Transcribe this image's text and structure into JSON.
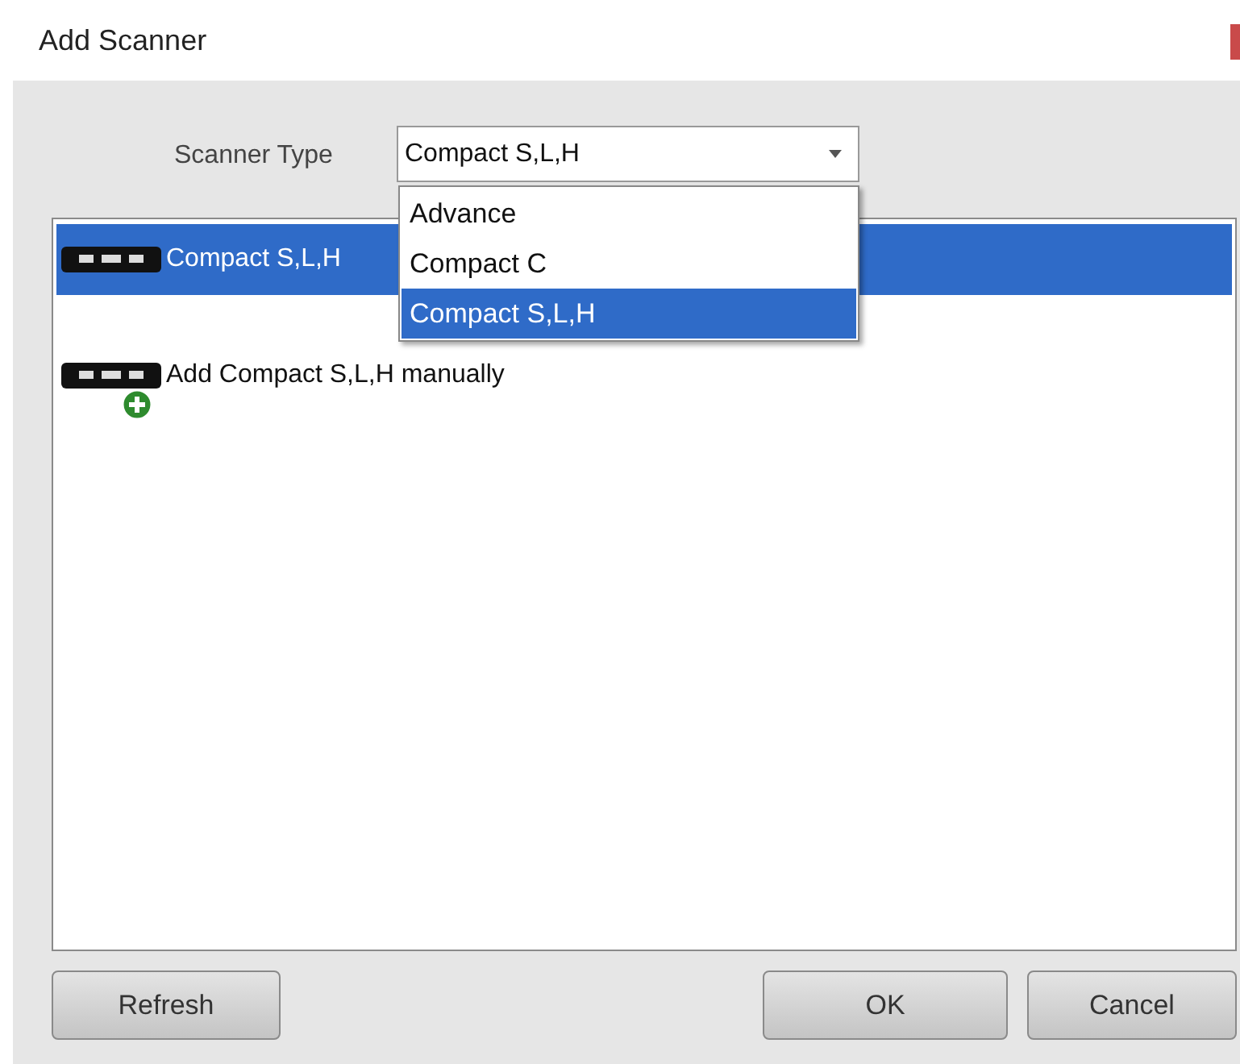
{
  "window": {
    "title": "Add Scanner"
  },
  "scanner_type": {
    "label": "Scanner Type",
    "value": "Compact S,L,H",
    "expanded": true,
    "options": [
      {
        "label": "Advance",
        "selected": false
      },
      {
        "label": "Compact C",
        "selected": false
      },
      {
        "label": "Compact S,L,H",
        "selected": true
      }
    ]
  },
  "scanners": [
    {
      "label": "Compact S,L,H",
      "kind": "device",
      "selected": true
    },
    {
      "label": "Add Compact S,L,H manually",
      "kind": "add",
      "selected": false
    }
  ],
  "buttons": {
    "left": [
      "Refresh"
    ],
    "right": [
      "OK",
      "Cancel"
    ]
  }
}
